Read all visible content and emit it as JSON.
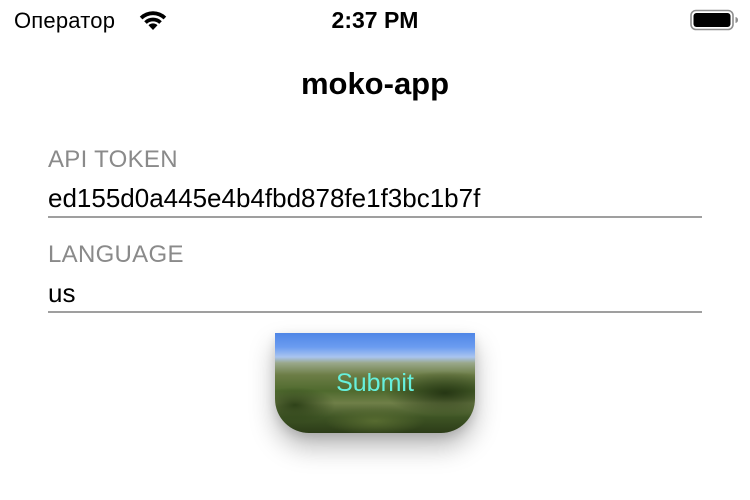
{
  "status_bar": {
    "carrier": "Оператор",
    "time": "2:37 PM",
    "wifi_icon": "wifi-icon",
    "battery_icon": "battery-full-icon"
  },
  "nav": {
    "title": "moko-app"
  },
  "form": {
    "api_token": {
      "label": "API TOKEN",
      "value": "ed155d0a445e4b4fbd878fe1f3bc1b7f"
    },
    "language": {
      "label": "LANGUAGE",
      "value": "us"
    },
    "submit": {
      "label": "Submit",
      "label_color": "#66f0dd"
    }
  }
}
